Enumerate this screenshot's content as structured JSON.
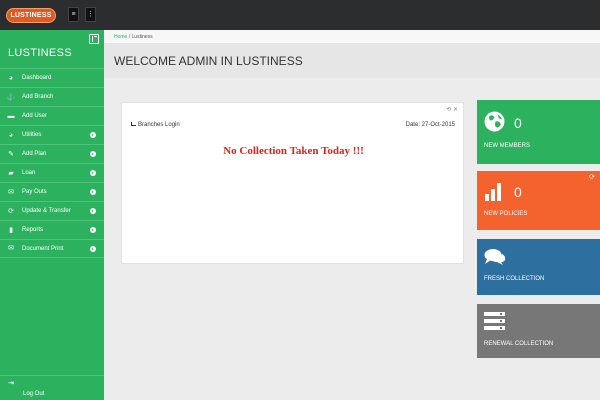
{
  "topbar": {
    "logo": "LUSTINESS",
    "btn_menu": "≡",
    "btn_more": "⋮"
  },
  "sidebar": {
    "brand": "LUSTINESS",
    "items": [
      {
        "label": "Dashboard",
        "icon": "dashboard-icon",
        "glyph": "◕",
        "submenu": false
      },
      {
        "label": "Add Branch",
        "icon": "anchor-icon",
        "glyph": "⚓",
        "submenu": false
      },
      {
        "label": "Add User",
        "icon": "user-icon",
        "glyph": "▬",
        "submenu": false
      },
      {
        "label": "Utilities",
        "icon": "pie-chart-icon",
        "glyph": "◕",
        "submenu": true
      },
      {
        "label": "Add Plan",
        "icon": "pencil-icon",
        "glyph": "✎",
        "submenu": true
      },
      {
        "label": "Loan",
        "icon": "document-icon",
        "glyph": "▰",
        "submenu": true
      },
      {
        "label": "Pay Outs",
        "icon": "envelope-icon",
        "glyph": "✉",
        "submenu": true
      },
      {
        "label": "Update & Transfer",
        "icon": "refresh-icon",
        "glyph": "⟳",
        "submenu": true
      },
      {
        "label": "Reports",
        "icon": "file-icon",
        "glyph": "▮",
        "submenu": true
      },
      {
        "label": "Document Print",
        "icon": "envelope-icon",
        "glyph": "✉",
        "submenu": true
      }
    ],
    "logout": {
      "label": "Log Out",
      "icon": "logout-icon",
      "glyph": "⇥"
    }
  },
  "breadcrumb": {
    "home": "Home",
    "sep": "/",
    "current": "Lustiness"
  },
  "header": {
    "title": "WELCOME ADMIN IN LUSTINESS"
  },
  "panel": {
    "tools": "⟲ ✕",
    "title": "Branches Login",
    "date": "Date: 27-Oct-2015",
    "message": "No Collection Taken Today !!!"
  },
  "tiles": [
    {
      "label": "NEW MEMBERS",
      "value": "0",
      "color": "#2cb25f",
      "icon": "globe-icon"
    },
    {
      "label": "NEW POLICIES",
      "value": "0",
      "color": "#f4622e",
      "icon": "bar-chart-icon",
      "refresh": "⟳"
    },
    {
      "label": "FRESH COLLECTION",
      "value": "",
      "color": "#2d6f9e",
      "icon": "comments-icon"
    },
    {
      "label": "RENEWAL COLLECTION",
      "value": "",
      "color": "#777777",
      "icon": "server-icon"
    }
  ]
}
